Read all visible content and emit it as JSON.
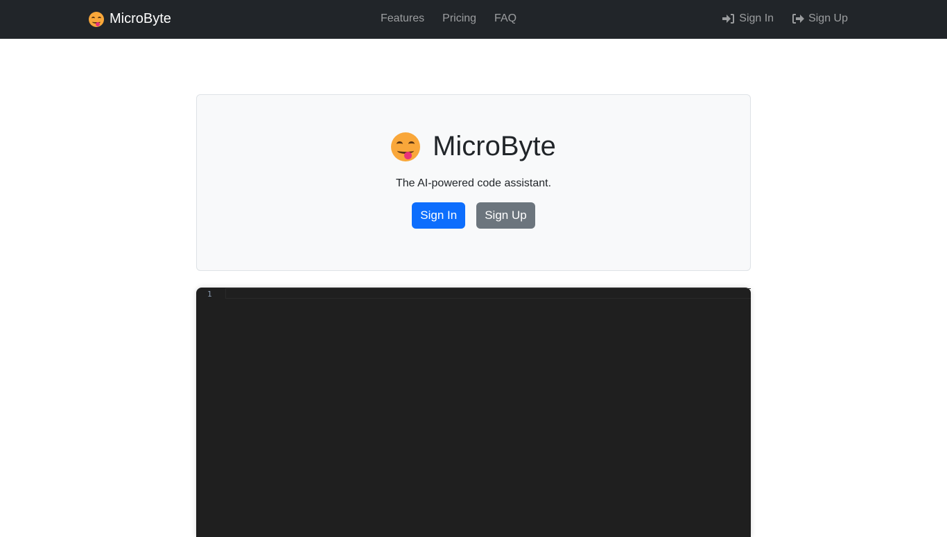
{
  "navbar": {
    "brand": "MicroByte",
    "links": [
      "Features",
      "Pricing",
      "FAQ"
    ],
    "sign_in": "Sign In",
    "sign_up": "Sign Up"
  },
  "hero": {
    "title": "MicroByte",
    "tagline": "The AI-powered code assistant.",
    "sign_in_button": "Sign In",
    "sign_up_button": "Sign Up"
  },
  "editor": {
    "line_numbers": [
      "1"
    ],
    "content": ""
  }
}
